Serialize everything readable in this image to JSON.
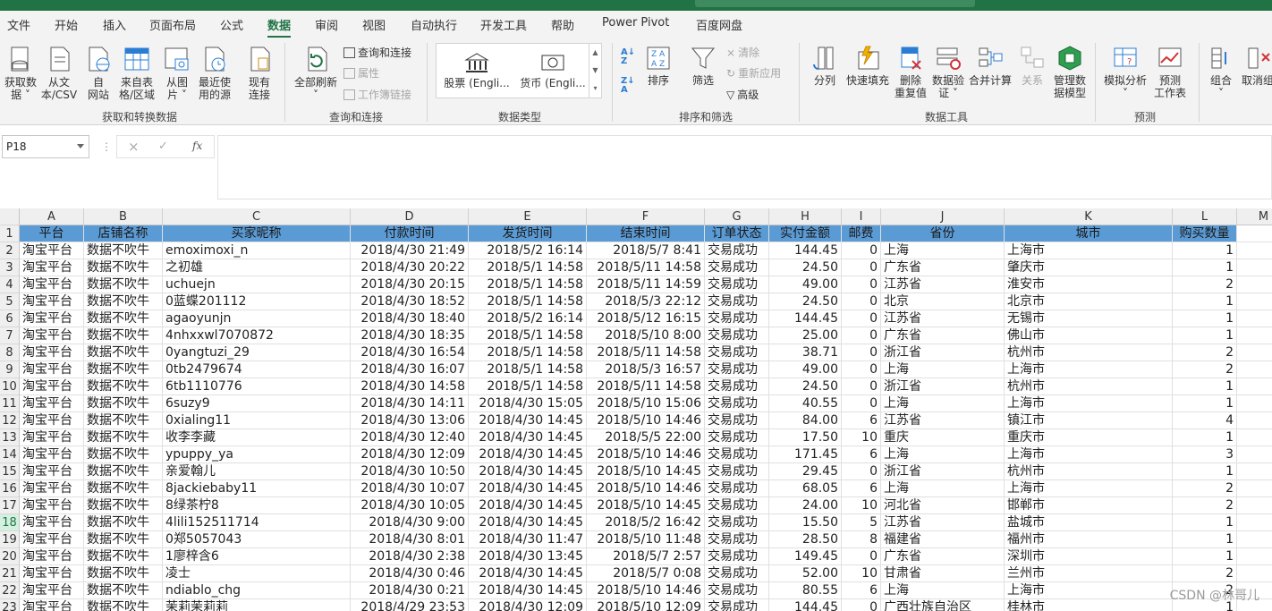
{
  "menu": [
    "文件",
    "开始",
    "插入",
    "页面布局",
    "公式",
    "数据",
    "审阅",
    "视图",
    "自动执行",
    "开发工具",
    "帮助",
    "Power Pivot",
    "百度网盘"
  ],
  "active_tab": "数据",
  "ribbon": {
    "get_data": "获取数\n据 ˅",
    "from_text": "从文\n本/CSV",
    "from_web": "自\n网站",
    "from_table": "来自表\n格/区域",
    "from_picture": "从图\n片 ˅",
    "recent_sources": "最近使\n用的源",
    "existing_conn": "现有\n连接",
    "group_get_transform": "获取和转换数据",
    "refresh_all": "全部刷新\n˅",
    "queries_conn": "查询和连接",
    "properties": "属性",
    "edit_links": "工作簿链接",
    "group_queries": "查询和连接",
    "stocks": "股票 (Engli...",
    "currency": "货币 (Engli...",
    "group_data_types": "数据类型",
    "sort": "排序",
    "filter": "筛选",
    "clear": "清除",
    "reapply": "重新应用",
    "advanced": "高级",
    "group_sort_filter": "排序和筛选",
    "text_to_columns": "分列",
    "flash_fill": "快速填充",
    "remove_dup": "删除\n重复值",
    "validation": "数据验\n证 ˅",
    "consolidate": "合并计算",
    "relationships": "关系",
    "manage_model": "管理数\n据模型",
    "group_data_tools": "数据工具",
    "what_if": "模拟分析\n˅",
    "forecast": "预测\n工作表",
    "group_forecast": "预测",
    "group": "组合\n˅",
    "ungroup": "取消组"
  },
  "formula_bar": {
    "name_box": "P18",
    "cancel": "×",
    "enter": "✓",
    "fx": "fx",
    "content": ""
  },
  "columns": [
    "A",
    "B",
    "C",
    "D",
    "E",
    "F",
    "G",
    "H",
    "I",
    "J",
    "K",
    "L",
    "M"
  ],
  "headers": [
    "平台",
    "店铺名称",
    "买家昵称",
    "付款时间",
    "发货时间",
    "结束时间",
    "订单状态",
    "实付金额",
    "邮费",
    "省份",
    "城市",
    "购买数量"
  ],
  "rows": [
    [
      "淘宝平台",
      "数据不吹牛",
      "emoximoxi_n",
      "2018/4/30 21:49",
      "2018/5/2 16:14",
      "2018/5/7 8:41",
      "交易成功",
      "144.45",
      "0",
      "上海",
      "上海市",
      "1"
    ],
    [
      "淘宝平台",
      "数据不吹牛",
      "之初雄",
      "2018/4/30 20:22",
      "2018/5/1 14:58",
      "2018/5/11 14:58",
      "交易成功",
      "24.50",
      "0",
      "广东省",
      "肇庆市",
      "1"
    ],
    [
      "淘宝平台",
      "数据不吹牛",
      "uchuejn",
      "2018/4/30 20:15",
      "2018/5/1 14:58",
      "2018/5/11 14:59",
      "交易成功",
      "49.00",
      "0",
      "江苏省",
      "淮安市",
      "2"
    ],
    [
      "淘宝平台",
      "数据不吹牛",
      "0蓝蝶201112",
      "2018/4/30 18:52",
      "2018/5/1 14:58",
      "2018/5/3 22:12",
      "交易成功",
      "24.50",
      "0",
      "北京",
      "北京市",
      "1"
    ],
    [
      "淘宝平台",
      "数据不吹牛",
      "agaoyunjn",
      "2018/4/30 18:40",
      "2018/5/2 16:14",
      "2018/5/12 16:15",
      "交易成功",
      "144.45",
      "0",
      "江苏省",
      "无锡市",
      "1"
    ],
    [
      "淘宝平台",
      "数据不吹牛",
      "4nhxxwl7070872",
      "2018/4/30 18:35",
      "2018/5/1 14:58",
      "2018/5/10 8:00",
      "交易成功",
      "25.00",
      "0",
      "广东省",
      "佛山市",
      "1"
    ],
    [
      "淘宝平台",
      "数据不吹牛",
      "0yangtuzi_29",
      "2018/4/30 16:54",
      "2018/5/1 14:58",
      "2018/5/11 14:58",
      "交易成功",
      "38.71",
      "0",
      "浙江省",
      "杭州市",
      "2"
    ],
    [
      "淘宝平台",
      "数据不吹牛",
      "0tb2479674",
      "2018/4/30 16:07",
      "2018/5/1 14:58",
      "2018/5/3 16:57",
      "交易成功",
      "49.00",
      "0",
      "上海",
      "上海市",
      "2"
    ],
    [
      "淘宝平台",
      "数据不吹牛",
      "6tb1110776",
      "2018/4/30 14:58",
      "2018/5/1 14:58",
      "2018/5/11 14:58",
      "交易成功",
      "24.50",
      "0",
      "浙江省",
      "杭州市",
      "1"
    ],
    [
      "淘宝平台",
      "数据不吹牛",
      "6suzy9",
      "2018/4/30 14:11",
      "2018/4/30 15:05",
      "2018/5/10 15:06",
      "交易成功",
      "40.55",
      "0",
      "上海",
      "上海市",
      "1"
    ],
    [
      "淘宝平台",
      "数据不吹牛",
      "0xialing11",
      "2018/4/30 13:06",
      "2018/4/30 14:45",
      "2018/5/10 14:46",
      "交易成功",
      "84.00",
      "6",
      "江苏省",
      "镇江市",
      "4"
    ],
    [
      "淘宝平台",
      "数据不吹牛",
      "收李李藏",
      "2018/4/30 12:40",
      "2018/4/30 14:45",
      "2018/5/5 22:00",
      "交易成功",
      "17.50",
      "10",
      "重庆",
      "重庆市",
      "1"
    ],
    [
      "淘宝平台",
      "数据不吹牛",
      "ypuppy_ya",
      "2018/4/30 12:09",
      "2018/4/30 14:45",
      "2018/5/10 14:46",
      "交易成功",
      "171.45",
      "6",
      "上海",
      "上海市",
      "3"
    ],
    [
      "淘宝平台",
      "数据不吹牛",
      "亲爱翰儿",
      "2018/4/30 10:50",
      "2018/4/30 14:45",
      "2018/5/10 14:45",
      "交易成功",
      "29.45",
      "0",
      "浙江省",
      "杭州市",
      "1"
    ],
    [
      "淘宝平台",
      "数据不吹牛",
      "8jackiebaby11",
      "2018/4/30 10:07",
      "2018/4/30 14:45",
      "2018/5/10 14:46",
      "交易成功",
      "68.05",
      "6",
      "上海",
      "上海市",
      "2"
    ],
    [
      "淘宝平台",
      "数据不吹牛",
      "8绿茶柠8",
      "2018/4/30 10:05",
      "2018/4/30 14:45",
      "2018/5/10 14:45",
      "交易成功",
      "24.00",
      "10",
      "河北省",
      "邯郸市",
      "2"
    ],
    [
      "淘宝平台",
      "数据不吹牛",
      "4lili152511714",
      "2018/4/30 9:00",
      "2018/4/30 14:45",
      "2018/5/2 16:42",
      "交易成功",
      "15.50",
      "5",
      "江苏省",
      "盐城市",
      "1"
    ],
    [
      "淘宝平台",
      "数据不吹牛",
      "0郑5057043",
      "2018/4/30 8:01",
      "2018/4/30 11:47",
      "2018/5/10 11:48",
      "交易成功",
      "28.50",
      "8",
      "福建省",
      "福州市",
      "1"
    ],
    [
      "淘宝平台",
      "数据不吹牛",
      "1廖梓含6",
      "2018/4/30 2:38",
      "2018/4/30 13:45",
      "2018/5/7 2:57",
      "交易成功",
      "149.45",
      "0",
      "广东省",
      "深圳市",
      "1"
    ],
    [
      "淘宝平台",
      "数据不吹牛",
      "凌士",
      "2018/4/30 0:46",
      "2018/4/30 14:45",
      "2018/5/7 0:08",
      "交易成功",
      "52.00",
      "10",
      "甘肃省",
      "兰州市",
      "2"
    ],
    [
      "淘宝平台",
      "数据不吹牛",
      "ndiablo_chg",
      "2018/4/30 0:21",
      "2018/4/30 14:45",
      "2018/5/10 14:46",
      "交易成功",
      "80.55",
      "6",
      "上海",
      "上海市",
      "2"
    ],
    [
      "淘宝平台",
      "数据不吹牛",
      "茉莉茉莉莉",
      "2018/4/29 23:53",
      "2018/4/30 12:09",
      "2018/5/10 12:09",
      "交易成功",
      "144.45",
      "0",
      "广西壮族自治区",
      "桂林市",
      "1"
    ]
  ],
  "selected_row": "18",
  "watermark": "CSDN @林哥儿",
  "colors": {
    "excel_green": "#217346",
    "header_fill": "#5b9bd5",
    "heading_bg": "#efefef"
  }
}
